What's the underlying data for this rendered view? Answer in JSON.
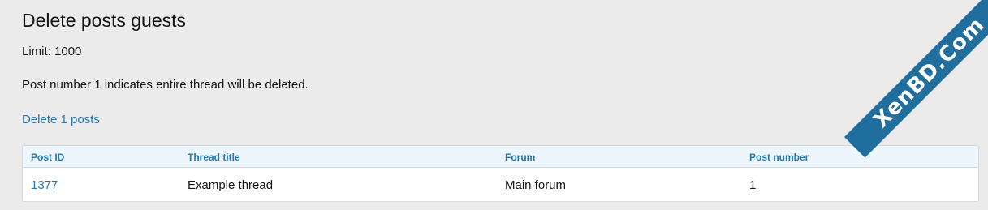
{
  "page": {
    "title": "Delete posts guests",
    "limit_text": "Limit: 1000",
    "note_text": "Post number 1 indicates entire thread will be deleted.",
    "delete_link": "Delete 1 posts"
  },
  "table": {
    "headers": [
      "Post ID",
      "Thread title",
      "Forum",
      "Post number"
    ],
    "rows": [
      {
        "post_id": "1377",
        "thread_title": "Example thread",
        "forum": "Main forum",
        "post_number": "1"
      }
    ]
  },
  "watermark": {
    "text": "XenBD.Com"
  },
  "colors": {
    "background": "#ebebeb",
    "link": "#2577b1",
    "header_bg": "#edf6fd",
    "watermark_bg": "#1f6e9e"
  }
}
